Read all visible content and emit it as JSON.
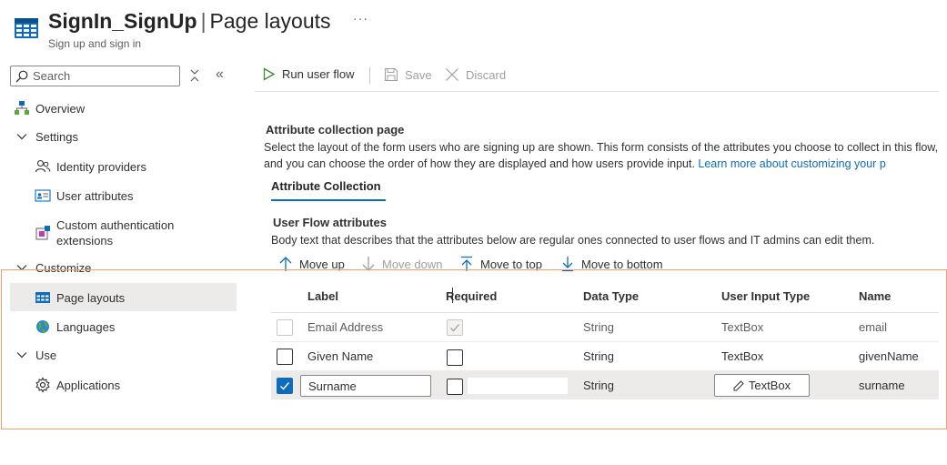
{
  "header": {
    "title_bold": "SignIn_SignUp",
    "separator": "|",
    "title_page": "Page layouts",
    "more": "···",
    "subtitle": "Sign up and sign in"
  },
  "search": {
    "placeholder": "Search"
  },
  "sidebar": {
    "collapse_x": "⨯",
    "collapse_dbl": "«",
    "items": [
      {
        "label": "Overview",
        "icon": "hierarchy-icon"
      },
      {
        "label": "Settings",
        "icon": "chevron-down-icon"
      },
      {
        "label": "Identity providers",
        "icon": "people-icon"
      },
      {
        "label": "User attributes",
        "icon": "id-card-icon"
      },
      {
        "label": "Custom authentication",
        "label2": "extensions",
        "icon": "extension-icon"
      },
      {
        "label": "Customize",
        "icon": "chevron-down-icon"
      },
      {
        "label": "Page layouts",
        "icon": "table-icon",
        "selected": true
      },
      {
        "label": "Languages",
        "icon": "globe-icon"
      },
      {
        "label": "Use",
        "icon": "chevron-down-icon"
      },
      {
        "label": "Applications",
        "icon": "gear-icon"
      }
    ]
  },
  "toolbar": {
    "run": "Run user flow",
    "save": "Save",
    "discard": "Discard"
  },
  "content": {
    "section_title": "Attribute collection page",
    "section_desc": "Select the layout of the form users who are signing up are shown. This form consists of the attributes you choose to collect in this flow, and you can choose the order of how they are displayed and how users provide input.",
    "learn_more": "Learn more about customizing your p",
    "tab": "Attribute Collection",
    "uf_title": "User Flow attributes",
    "uf_desc": "Body text that describes that the attributes below are regular ones connected to user flows and IT admins can edit them.",
    "move_up": "Move up",
    "move_down": "Move down",
    "move_top": "Move to top",
    "move_bottom": "Move to bottom"
  },
  "table": {
    "headers": [
      "Label",
      "Required",
      "Data Type",
      "User Input Type",
      "Name"
    ],
    "rows": [
      {
        "label": "Email Address",
        "required": true,
        "data_type": "String",
        "input_type": "TextBox",
        "name": "email",
        "selected": false,
        "disabled": true
      },
      {
        "label": "Given Name",
        "required": false,
        "data_type": "String",
        "input_type": "TextBox",
        "name": "givenName",
        "selected": false,
        "disabled": false
      },
      {
        "label": "Surname",
        "required": false,
        "data_type": "String",
        "input_type": "TextBox",
        "name": "surname",
        "selected": true,
        "disabled": false
      }
    ]
  },
  "colors": {
    "accent": "#0f6cbd",
    "highlight_frame": "#f4a06b",
    "selected_bg": "#edebe9"
  }
}
